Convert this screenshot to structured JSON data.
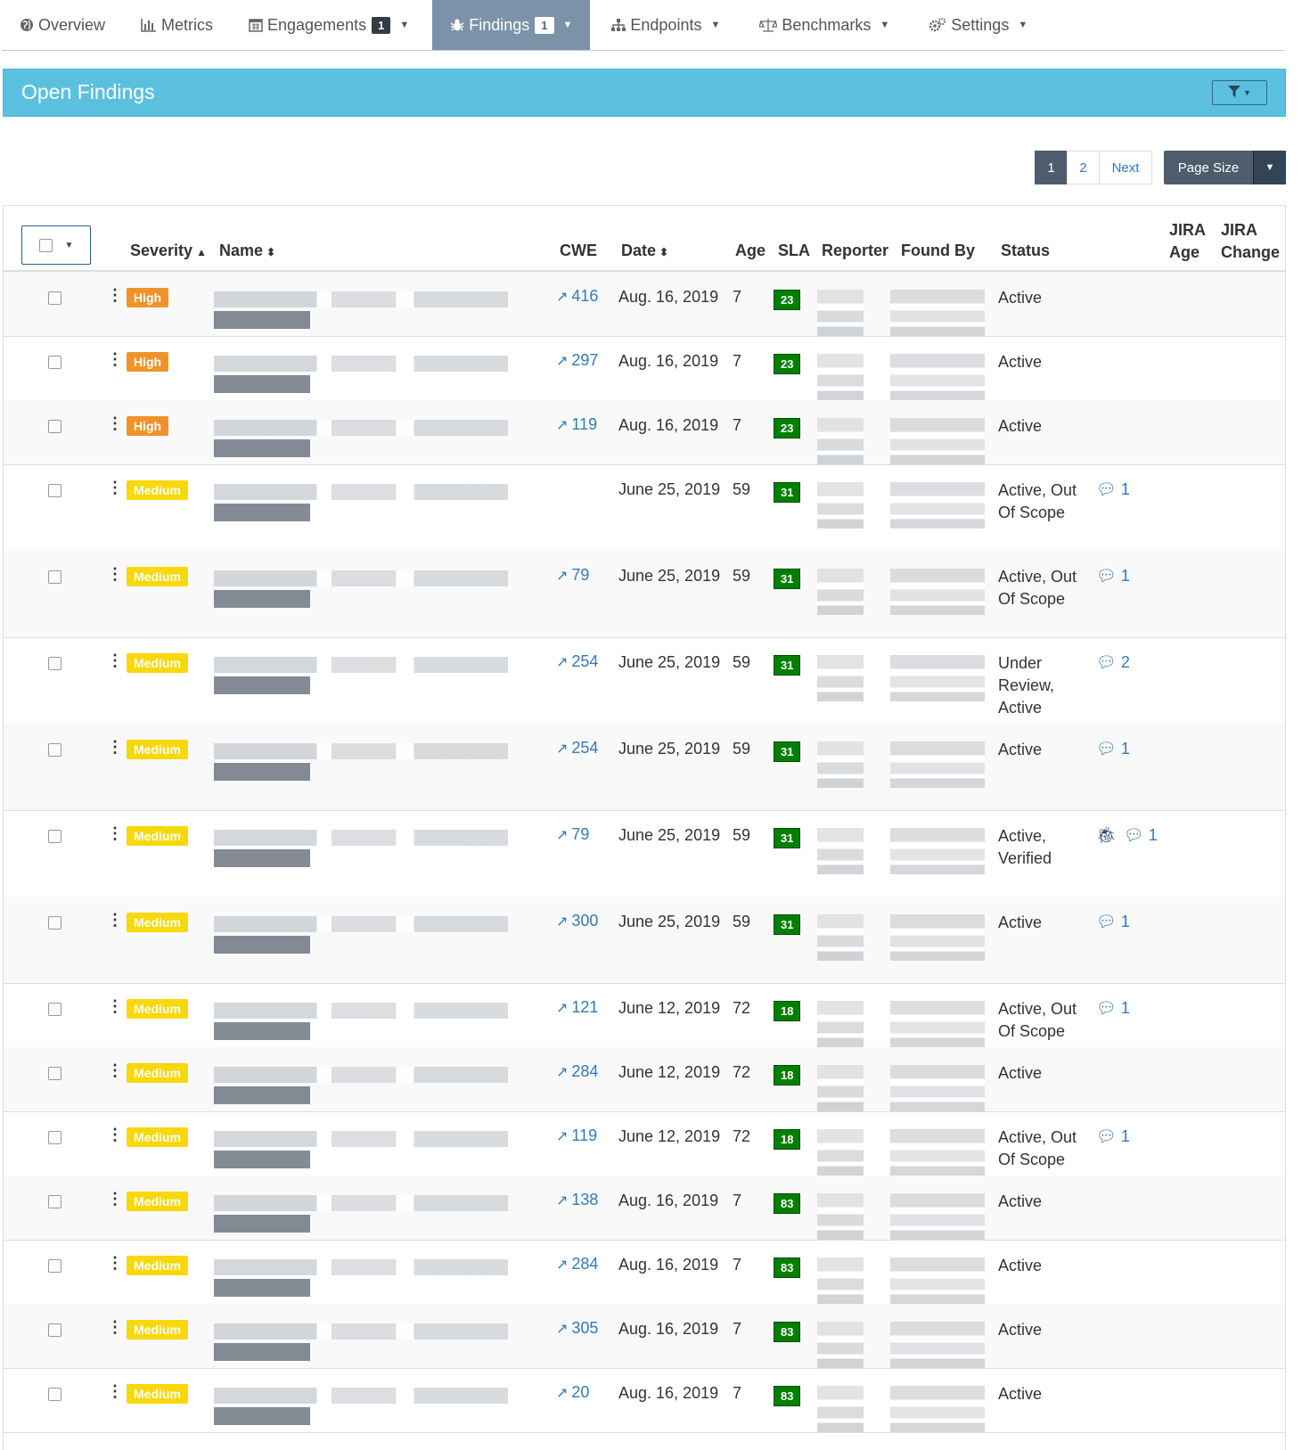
{
  "nav": [
    {
      "icon": "globe-icon",
      "label": "Overview"
    },
    {
      "icon": "bar-chart-icon",
      "label": "Metrics"
    },
    {
      "icon": "calendar-icon",
      "label": "Engagements",
      "count": "1",
      "dropdown": true
    },
    {
      "icon": "bug-icon",
      "label": "Findings",
      "count": "1",
      "dropdown": true,
      "active": true
    },
    {
      "icon": "sitemap-icon",
      "label": "Endpoints",
      "dropdown": true
    },
    {
      "icon": "balance-scale-icon",
      "label": "Benchmarks",
      "dropdown": true
    },
    {
      "icon": "gears-icon",
      "label": "Settings",
      "dropdown": true
    }
  ],
  "panel": {
    "title": "Open Findings"
  },
  "pagination": {
    "pages": [
      "1",
      "2"
    ],
    "current": "1",
    "next": "Next",
    "page_size": "Page Size"
  },
  "columns": {
    "severity": "Severity",
    "name": "Name",
    "cwe": "CWE",
    "date": "Date",
    "age": "Age",
    "sla": "SLA",
    "reporter": "Reporter",
    "found_by": "Found By",
    "status": "Status",
    "jira_age": "JIRA Age",
    "jira_change": "JIRA Change"
  },
  "rows": [
    {
      "severity": "High",
      "cwe": "416",
      "date": "Aug. 16, 2019",
      "age": "7",
      "sla": "23",
      "status": "Active",
      "notes": ""
    },
    {
      "severity": "High",
      "cwe": "297",
      "date": "Aug. 16, 2019",
      "age": "7",
      "sla": "23",
      "status": "Active",
      "notes": ""
    },
    {
      "severity": "High",
      "cwe": "119",
      "date": "Aug. 16, 2019",
      "age": "7",
      "sla": "23",
      "status": "Active",
      "notes": ""
    },
    {
      "severity": "Medium",
      "cwe": "",
      "date": "June 25, 2019",
      "age": "59",
      "sla": "31",
      "status": "Active, Out Of Scope",
      "notes": "1"
    },
    {
      "severity": "Medium",
      "cwe": "79",
      "date": "June 25, 2019",
      "age": "59",
      "sla": "31",
      "status": "Active, Out Of Scope",
      "notes": "1"
    },
    {
      "severity": "Medium",
      "cwe": "254",
      "date": "June 25, 2019",
      "age": "59",
      "sla": "31",
      "status": "Under Review, Active",
      "notes": "2"
    },
    {
      "severity": "Medium",
      "cwe": "254",
      "date": "June 25, 2019",
      "age": "59",
      "sla": "31",
      "status": "Active",
      "notes": "1"
    },
    {
      "severity": "Medium",
      "cwe": "79",
      "date": "June 25, 2019",
      "age": "59",
      "sla": "31",
      "status": "Active, Verified",
      "notes": "1",
      "bug": true
    },
    {
      "severity": "Medium",
      "cwe": "300",
      "date": "June 25, 2019",
      "age": "59",
      "sla": "31",
      "status": "Active",
      "notes": "1"
    },
    {
      "severity": "Medium",
      "cwe": "121",
      "date": "June 12, 2019",
      "age": "72",
      "sla": "18",
      "status": "Active, Out Of Scope",
      "notes": "1"
    },
    {
      "severity": "Medium",
      "cwe": "284",
      "date": "June 12, 2019",
      "age": "72",
      "sla": "18",
      "status": "Active",
      "notes": ""
    },
    {
      "severity": "Medium",
      "cwe": "119",
      "date": "June 12, 2019",
      "age": "72",
      "sla": "18",
      "status": "Active, Out Of Scope",
      "notes": "1"
    },
    {
      "severity": "Medium",
      "cwe": "138",
      "date": "Aug. 16, 2019",
      "age": "7",
      "sla": "83",
      "status": "Active",
      "notes": ""
    },
    {
      "severity": "Medium",
      "cwe": "284",
      "date": "Aug. 16, 2019",
      "age": "7",
      "sla": "83",
      "status": "Active",
      "notes": ""
    },
    {
      "severity": "Medium",
      "cwe": "305",
      "date": "Aug. 16, 2019",
      "age": "7",
      "sla": "83",
      "status": "Active",
      "notes": ""
    },
    {
      "severity": "Medium",
      "cwe": "20",
      "date": "Aug. 16, 2019",
      "age": "7",
      "sla": "83",
      "status": "Active",
      "notes": ""
    }
  ]
}
